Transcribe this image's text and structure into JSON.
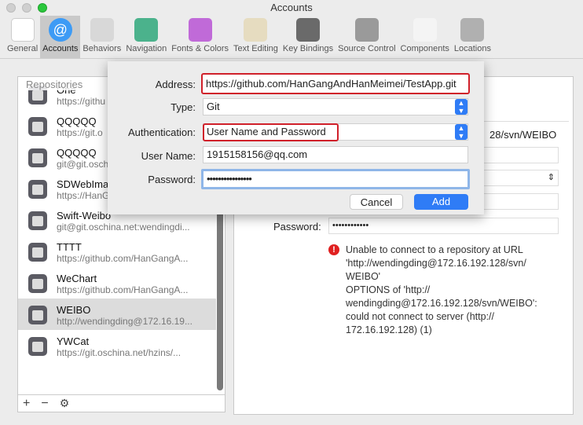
{
  "window": {
    "title": "Accounts"
  },
  "toolbar": [
    {
      "label": "General",
      "icon": "switch-icon",
      "color": "#ffffff"
    },
    {
      "label": "Accounts",
      "icon": "at-icon",
      "color": "#3d9bf5"
    },
    {
      "label": "Behaviors",
      "icon": "gear-icon",
      "color": "#d8d8d8"
    },
    {
      "label": "Navigation",
      "icon": "arrows-icon",
      "color": "#4bb28c"
    },
    {
      "label": "Fonts & Colors",
      "icon": "font-icon",
      "color": "#c06ad8"
    },
    {
      "label": "Text Editing",
      "icon": "pencil-icon",
      "color": "#e6dcc0"
    },
    {
      "label": "Key Bindings",
      "icon": "keyboard-icon",
      "color": "#6a6a6a"
    },
    {
      "label": "Source Control",
      "icon": "safe-icon",
      "color": "#9a9a9a"
    },
    {
      "label": "Components",
      "icon": "shield-icon",
      "color": "#f4f4f4"
    },
    {
      "label": "Locations",
      "icon": "joystick-icon",
      "color": "#b0b0b0"
    }
  ],
  "repositories": {
    "header": "Repositories",
    "items": [
      {
        "name": "",
        "url": "https://git.o"
      },
      {
        "name": "One",
        "url": "https://githu"
      },
      {
        "name": "QQQQQ",
        "url": "https://git.o"
      },
      {
        "name": "QQQQQ",
        "url": "git@git.osch"
      },
      {
        "name": "SDWebIma",
        "url": "https://HanGangAndHanMeimei..."
      },
      {
        "name": "Swift-Weibo",
        "url": "git@git.oschina.net:wendingdi..."
      },
      {
        "name": "TTTT",
        "url": "https://github.com/HanGangA..."
      },
      {
        "name": "WeChart",
        "url": "https://github.com/HanGangA..."
      },
      {
        "name": "WEIBO",
        "url": "http://wendingding@172.16.19...",
        "selected": true
      },
      {
        "name": "YWCat",
        "url": "https://git.oschina.net/hzins/..."
      }
    ],
    "add": "+",
    "remove": "−",
    "settings": "⚙"
  },
  "detail": {
    "address_tail": "28/svn/WEIBO",
    "password_label": "Password:",
    "password_value": "••••••••••••",
    "error": [
      "Unable to connect to a repository at URL",
      "'http://wendingding@172.16.192.128/svn/",
      "WEIBO'",
      "OPTIONS of 'http://",
      "wendingding@172.16.192.128/svn/WEIBO':",
      "could not connect to server (http://",
      "172.16.192.128) (1)"
    ]
  },
  "sheet": {
    "address_label": "Address:",
    "address_value": "https://github.com/HanGangAndHanMeimei/TestApp.git",
    "type_label": "Type:",
    "type_value": "Git",
    "auth_label": "Authentication:",
    "auth_value": "User Name and Password",
    "username_label": "User Name:",
    "username_value": "1915158156@qq.com",
    "password_label": "Password:",
    "password_value": "••••••••••••••••",
    "cancel": "Cancel",
    "add": "Add"
  }
}
